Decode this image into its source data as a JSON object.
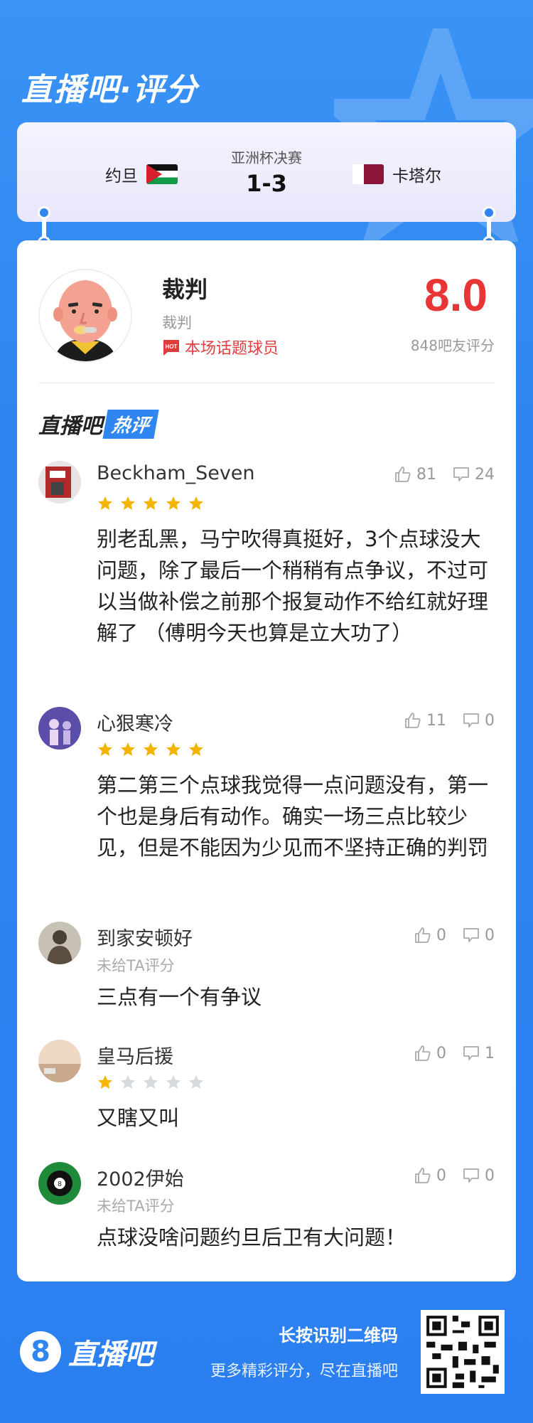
{
  "app": {
    "title": "直播吧·评分"
  },
  "match": {
    "home_team": "约旦",
    "away_team": "卡塔尔",
    "competition": "亚洲杯决赛",
    "score": "1-3"
  },
  "player": {
    "name": "裁判",
    "role": "裁判",
    "hot_label": "本场话题球员",
    "hot_badge_text": "HOT",
    "rating": "8.0",
    "rating_count": "848吧友评分"
  },
  "section": {
    "brand": "直播吧",
    "hot_title": "热评"
  },
  "comments": [
    {
      "user": "Beckham_Seven",
      "stars": 5,
      "likes": "81",
      "dislikes": "24",
      "text": "别老乱黑，马宁吹得真挺好，3个点球没大问题，除了最后一个稍稍有点争议，不过可以当做补偿之前那个报复动作不给红就好理解了 （傅明今天也算是立大功了）"
    },
    {
      "user": "心狠寒冷",
      "stars": 5,
      "likes": "11",
      "dislikes": "0",
      "text": "第二第三个点球我觉得一点问题没有，第一个也是身后有动作。确实一场三点比较少见，但是不能因为少见而不坚持正确的判罚"
    },
    {
      "user": "到家安顿好",
      "no_rating": "未给TA评分",
      "likes": "0",
      "dislikes": "0",
      "text": "三点有一个有争议"
    },
    {
      "user": "皇马后援",
      "stars": 1,
      "likes": "0",
      "dislikes": "1",
      "text": "又瞎又叫"
    },
    {
      "user": "2002伊始",
      "no_rating": "未给TA评分",
      "likes": "0",
      "dislikes": "0",
      "text": "点球没啥问题约旦后卫有大问题！"
    }
  ],
  "footer": {
    "brand": "直播吧",
    "logo_digit": "8",
    "qr_title": "长按识别二维码",
    "qr_subtitle": "更多精彩评分，尽在直播吧"
  },
  "colors": {
    "accent": "#2f86f0",
    "rating": "#e83535",
    "star_on": "#f5b400",
    "star_off": "#d6d9de"
  }
}
